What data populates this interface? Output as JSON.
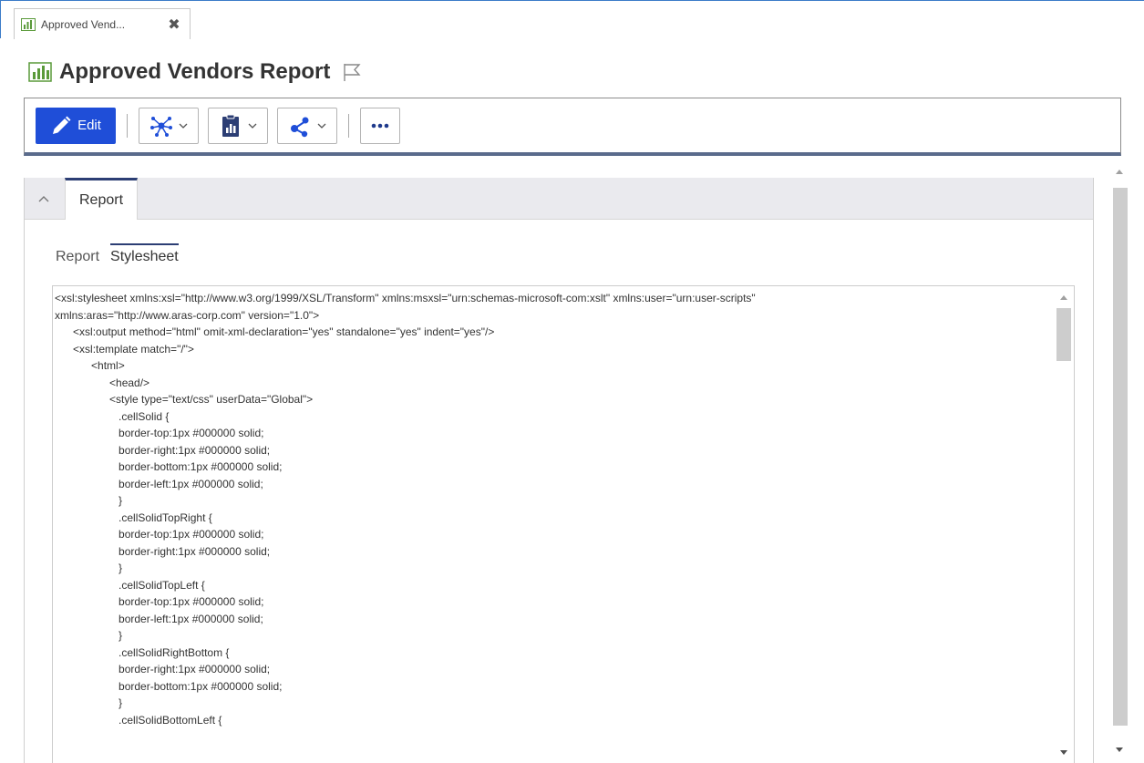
{
  "window_tab": {
    "label": "Approved Vend...",
    "close_glyph": "✖"
  },
  "header": {
    "title": "Approved Vendors Report",
    "icon": "report-chart-icon"
  },
  "toolbar": {
    "edit_label": "Edit",
    "accent_color": "#1f4ed8",
    "buttons": [
      "network-icon",
      "report-clipboard-icon",
      "share-icon",
      "more-icon"
    ]
  },
  "panel": {
    "section_tab": "Report",
    "sub_tabs": [
      "Report",
      "Stylesheet"
    ],
    "active_sub_tab": "Stylesheet",
    "code": "<xsl:stylesheet xmlns:xsl=\"http://www.w3.org/1999/XSL/Transform\" xmlns:msxsl=\"urn:schemas-microsoft-com:xslt\" xmlns:user=\"urn:user-scripts\"\nxmlns:aras=\"http://www.aras-corp.com\" version=\"1.0\">\n\t<xsl:output method=\"html\" omit-xml-declaration=\"yes\" standalone=\"yes\" indent=\"yes\"/>\n\t<xsl:template match=\"/\">\n\t\t<html>\n\t\t\t<head/>\n\t\t\t<style type=\"text/css\" userData=\"Global\">\n\t\t\t   .cellSolid {\n\t\t\t   border-top:1px #000000 solid;\n\t\t\t   border-right:1px #000000 solid;\n\t\t\t   border-bottom:1px #000000 solid;\n\t\t\t   border-left:1px #000000 solid;\n\t\t\t   }\n\t\t\t   .cellSolidTopRight {\n\t\t\t   border-top:1px #000000 solid;\n\t\t\t   border-right:1px #000000 solid;\n\t\t\t   }\n\t\t\t   .cellSolidTopLeft {\n\t\t\t   border-top:1px #000000 solid;\n\t\t\t   border-left:1px #000000 solid;\n\t\t\t   }\n\t\t\t   .cellSolidRightBottom {\n\t\t\t   border-right:1px #000000 solid;\n\t\t\t   border-bottom:1px #000000 solid;\n\t\t\t   }\n\t\t\t   .cellSolidBottomLeft {"
  }
}
